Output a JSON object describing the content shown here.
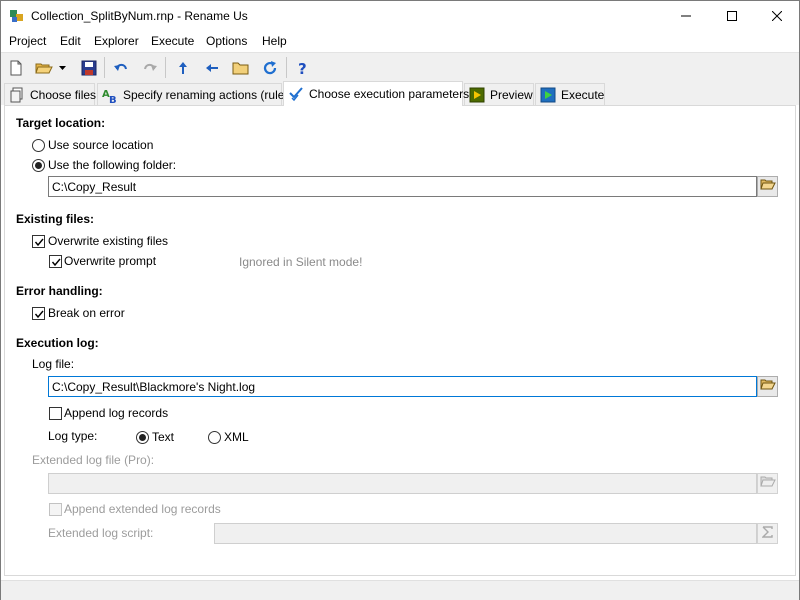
{
  "window": {
    "title": "Collection_SplitByNum.rnp - Rename Us",
    "controls": {
      "minimize": "minimize",
      "maximize": "maximize",
      "close": "close"
    }
  },
  "menu": [
    "Project",
    "Edit",
    "Explorer",
    "Execute",
    "Options",
    "Help"
  ],
  "toolbar": {
    "icons": [
      "new-icon",
      "open-icon",
      "dropdown-icon",
      "save-icon",
      "undo-icon",
      "redo-icon",
      "move-up-icon",
      "move-left-icon",
      "folder-icon",
      "refresh-icon",
      "help-icon"
    ]
  },
  "tabs": [
    {
      "label": "Choose files",
      "icon": "files-icon",
      "active": false
    },
    {
      "label": "Specify renaming actions (rules)",
      "icon": "rename-rules-icon",
      "active": false
    },
    {
      "label": "Choose execution parameters",
      "icon": "checkmark-icon",
      "active": true
    },
    {
      "label": "Preview",
      "icon": "play-icon",
      "active": false
    },
    {
      "label": "Execute",
      "icon": "execute-icon",
      "active": false
    }
  ],
  "target": {
    "heading": "Target location:",
    "use_source": "Use source location",
    "use_folder": "Use the following folder:",
    "folder_value": "C:\\Copy_Result",
    "selected": "folder"
  },
  "existing": {
    "heading": "Existing files:",
    "overwrite": "Overwrite existing files",
    "overwrite_checked": true,
    "prompt": "Overwrite prompt",
    "prompt_checked": true,
    "hint": "Ignored in Silent mode!"
  },
  "errors": {
    "heading": "Error handling:",
    "break": "Break on error",
    "break_checked": true
  },
  "log": {
    "heading": "Execution log:",
    "file_label": "Log file:",
    "file_value": "C:\\Copy_Result\\Blackmore's Night.log",
    "append": "Append log records",
    "append_checked": false,
    "type_label": "Log type:",
    "type_text": "Text",
    "type_xml": "XML",
    "type_selected": "Text",
    "ext_file_label": "Extended log file (Pro):",
    "ext_file_value": "",
    "ext_append": "Append extended log records",
    "ext_script_label": "Extended log script:",
    "ext_script_value": ""
  },
  "colors": {
    "accent": "#0078d7",
    "disabled_text": "#9c9c9c"
  }
}
